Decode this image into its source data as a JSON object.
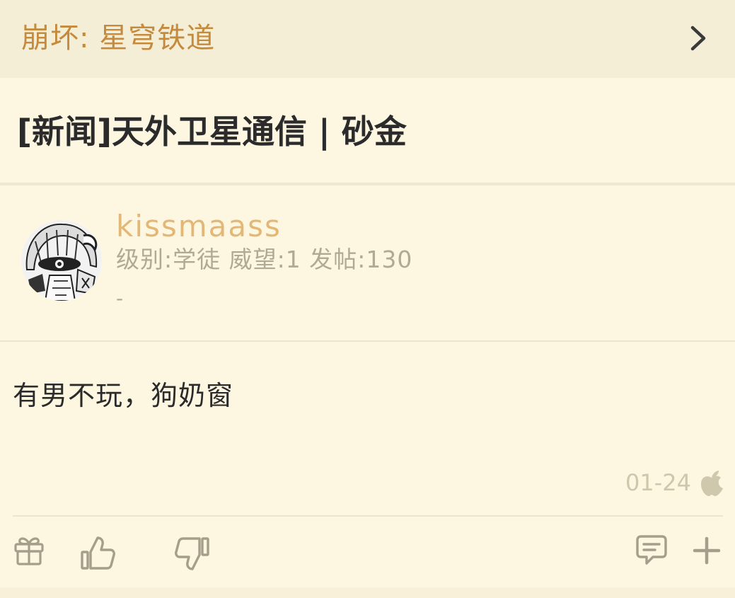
{
  "header": {
    "forum_name": "崩坏: 星穹铁道",
    "forward_icon": "chevron-right-icon"
  },
  "post": {
    "title": "[新闻]天外卫星通信 | 砂金",
    "author": {
      "username": "kissmaass",
      "info": "级别:学徒 威望:1 发帖:130",
      "signature": "-",
      "avatar_icon": "user-avatar"
    },
    "content": "有男不玩，狗奶窗",
    "date": "01-24",
    "device_icon": "apple-icon"
  },
  "actions": [
    "gift-icon",
    "thumbs-up-icon",
    "thumbs-down-icon",
    "comment-icon",
    "plus-icon"
  ],
  "colors": {
    "background": "#fdf7e2",
    "header_bg": "#f4eed6",
    "forum_name": "#c58a3c",
    "username": "#e3b775",
    "meta_text": "#b0a994",
    "icon": "#a49e8a"
  }
}
